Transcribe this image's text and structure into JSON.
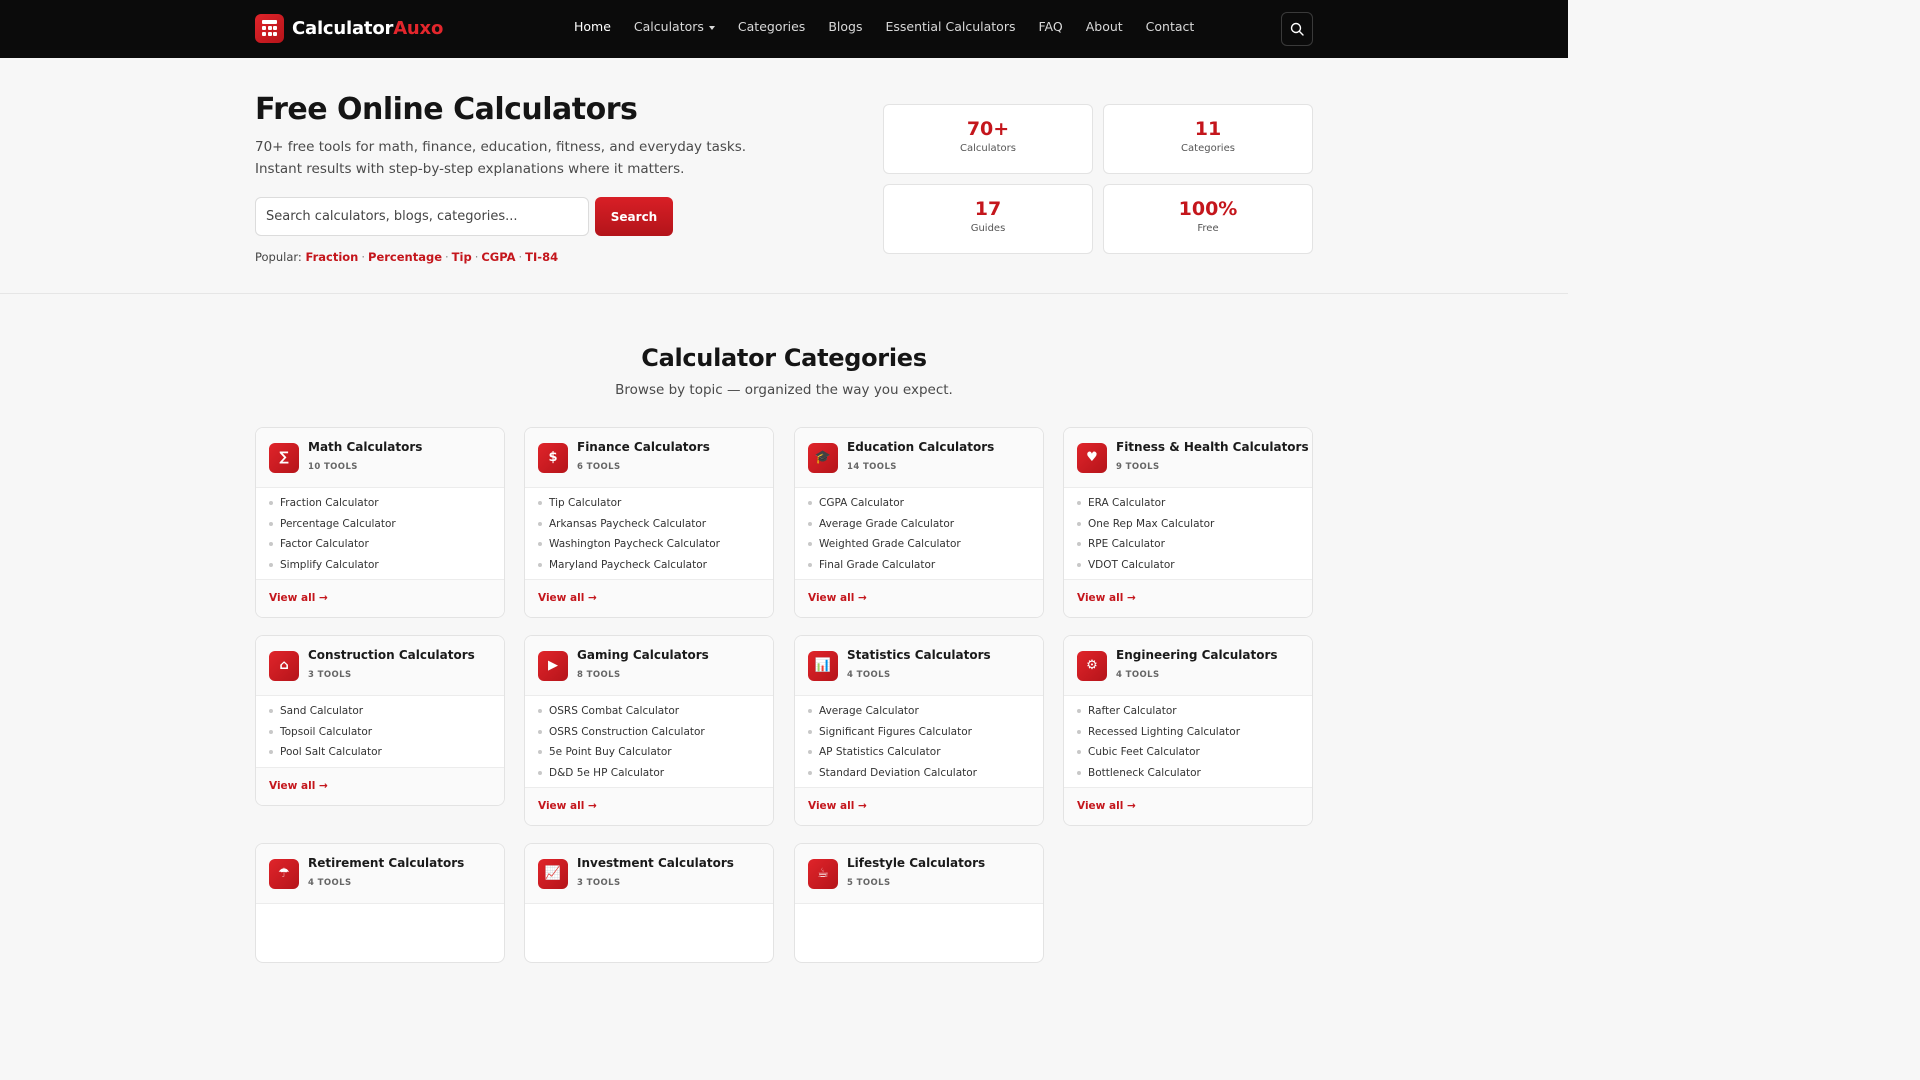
{
  "brand": {
    "name_main": "Calculator",
    "name_accent": "Auxo"
  },
  "nav": {
    "home": "Home",
    "calculators": "Calculators",
    "categories": "Categories",
    "blogs": "Blogs",
    "essential": "Essential Calculators",
    "faq": "FAQ",
    "about": "About",
    "contact": "Contact"
  },
  "hero": {
    "title": "Free Online Calculators",
    "subtitle_line1": "70+ free tools for math, finance, education, fitness, and everyday tasks.",
    "subtitle_line2": "Instant results with step-by-step explanations where it matters.",
    "search_placeholder": "Search calculators, blogs, categories...",
    "search_button": "Search",
    "popular_label": "Popular:",
    "popular_links": [
      "Fraction",
      "Percentage",
      "Tip",
      "CGPA",
      "TI-84"
    ],
    "stats": [
      {
        "value": "70+",
        "label": "Calculators"
      },
      {
        "value": "11",
        "label": "Categories"
      },
      {
        "value": "17",
        "label": "Guides"
      },
      {
        "value": "100%",
        "label": "Free"
      }
    ]
  },
  "categories_section": {
    "title": "Calculator Categories",
    "subtitle": "Browse by topic — organized the way you expect.",
    "view_all": "View all →",
    "cards": [
      {
        "title": "Math Calculators",
        "count": "10 TOOLS",
        "icon": "sigma-icon",
        "glyph": "∑",
        "items": [
          "Fraction Calculator",
          "Percentage Calculator",
          "Factor Calculator",
          "Simplify Calculator"
        ]
      },
      {
        "title": "Finance Calculators",
        "count": "6 TOOLS",
        "icon": "dollar-icon",
        "glyph": "$",
        "items": [
          "Tip Calculator",
          "Arkansas Paycheck Calculator",
          "Washington Paycheck Calculator",
          "Maryland Paycheck Calculator"
        ]
      },
      {
        "title": "Education Calculators",
        "count": "14 TOOLS",
        "icon": "graduation-cap-icon",
        "glyph": "🎓",
        "items": [
          "CGPA Calculator",
          "Average Grade Calculator",
          "Weighted Grade Calculator",
          "Final Grade Calculator"
        ]
      },
      {
        "title": "Fitness & Health Calculators",
        "count": "9 TOOLS",
        "icon": "heart-icon",
        "glyph": "♥",
        "items": [
          "ERA Calculator",
          "One Rep Max Calculator",
          "RPE Calculator",
          "VDOT Calculator"
        ]
      },
      {
        "title": "Construction Calculators",
        "count": "3 TOOLS",
        "icon": "house-icon",
        "glyph": "⌂",
        "items": [
          "Sand Calculator",
          "Topsoil Calculator",
          "Pool Salt Calculator"
        ]
      },
      {
        "title": "Gaming Calculators",
        "count": "8 TOOLS",
        "icon": "play-icon",
        "glyph": "▶",
        "items": [
          "OSRS Combat Calculator",
          "OSRS Construction Calculator",
          "5e Point Buy Calculator",
          "D&D 5e HP Calculator"
        ]
      },
      {
        "title": "Statistics Calculators",
        "count": "4 TOOLS",
        "icon": "bar-chart-icon",
        "glyph": "📊",
        "items": [
          "Average Calculator",
          "Significant Figures Calculator",
          "AP Statistics Calculator",
          "Standard Deviation Calculator"
        ]
      },
      {
        "title": "Engineering Calculators",
        "count": "4 TOOLS",
        "icon": "gear-icon",
        "glyph": "⚙",
        "items": [
          "Rafter Calculator",
          "Recessed Lighting Calculator",
          "Cubic Feet Calculator",
          "Bottleneck Calculator"
        ]
      },
      {
        "title": "Retirement Calculators",
        "count": "4 TOOLS",
        "icon": "umbrella-icon",
        "glyph": "☂",
        "items": []
      },
      {
        "title": "Investment Calculators",
        "count": "3 TOOLS",
        "icon": "trend-icon",
        "glyph": "📈",
        "items": []
      },
      {
        "title": "Lifestyle Calculators",
        "count": "5 TOOLS",
        "icon": "cup-icon",
        "glyph": "☕",
        "items": []
      }
    ]
  }
}
